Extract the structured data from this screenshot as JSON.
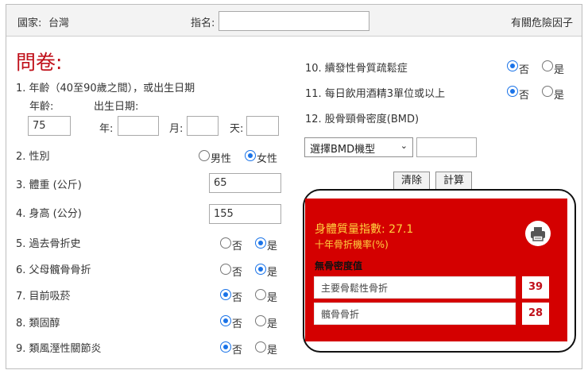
{
  "header": {
    "country_label": "國家:",
    "country_value": "台灣",
    "name_label": "指名:",
    "name_value": "",
    "risk_link": "有關危險因子"
  },
  "questionnaire": {
    "title": "問卷:",
    "q1": {
      "label": "1. 年齡（40至90歲之間），或出生日期",
      "age_label": "年齡:",
      "age_value": "75",
      "dob_label": "出生日期:",
      "year_label": "年:",
      "month_label": "月:",
      "day_label": "天:",
      "year_value": "",
      "month_value": "",
      "day_value": ""
    },
    "q2": {
      "label": "2. 性別",
      "male": "男性",
      "female": "女性",
      "selected": "female"
    },
    "q3": {
      "label": "3. 體重 (公斤)",
      "value": "65"
    },
    "q4": {
      "label": "4. 身高 (公分)",
      "value": "155"
    },
    "q5": {
      "label": "5. 過去骨折史",
      "selected": "yes"
    },
    "q6": {
      "label": "6. 父母髖骨骨折",
      "selected": "yes"
    },
    "q7": {
      "label": "7. 目前吸菸",
      "selected": "no"
    },
    "q8": {
      "label": "8. 類固醇",
      "selected": "no"
    },
    "q9": {
      "label": "9. 類風溼性關節炎",
      "selected": "no"
    },
    "q10": {
      "label": "10. 續發性骨質疏鬆症",
      "selected": "no"
    },
    "q11": {
      "label": "11. 每日飲用酒精3單位或以上",
      "selected": "no"
    },
    "q12": {
      "label": "12. 股骨頸骨密度(BMD)",
      "select_value": "選擇BMD機型",
      "bmd_value": ""
    },
    "no_label": "否",
    "yes_label": "是"
  },
  "buttons": {
    "clear": "清除",
    "calculate": "計算"
  },
  "results": {
    "bmi_label": "身體質量指數:",
    "bmi_value": "27.1",
    "ten_year_label": "十年骨折機率(%)",
    "no_bmd_label": "無骨密度值",
    "major_label": "主要骨鬆性骨折",
    "major_value": "39",
    "hip_label": "髖骨骨折",
    "hip_value": "28"
  },
  "colors": {
    "accent_red": "#d40000",
    "radio_blue": "#1a73e8",
    "link_blue": "#1a56b8",
    "result_yellow": "#ffd23f"
  }
}
